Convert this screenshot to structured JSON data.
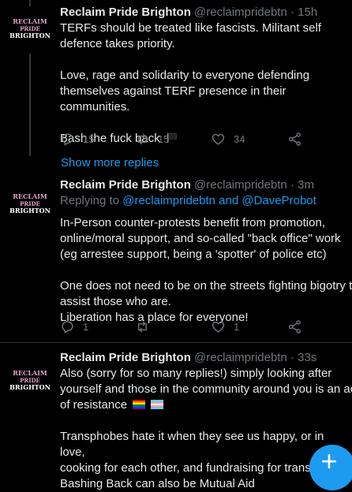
{
  "avatar": {
    "line1": "RECLAIM",
    "line2": "PRIDE",
    "line3": "BRIGHTON"
  },
  "tweets": [
    {
      "name": "Reclaim Pride Brighton",
      "handle": "@reclaimpridebtn",
      "sep": "·",
      "time": "15h",
      "lines": [
        "TERFs should be treated like fascists. Militant self",
        "defence takes priority.",
        "",
        "Love, rage and solidarity to everyone defending",
        "themselves against TERF presence in their communities.",
        "",
        "Bash the fuck back"
      ],
      "replies": "15",
      "retweets": "15",
      "likes": "34"
    },
    {
      "name": "Reclaim Pride Brighton",
      "handle": "@reclaimpridebtn",
      "sep": "·",
      "time": "3m",
      "replying_label": "Replying to",
      "reply_user1": "@reclaimpridebtn",
      "reply_and": "and",
      "reply_user2": "@DaveProbot",
      "lines": [
        "In-Person counter-protests benefit from promotion,",
        "online/moral support, and so-called \"back office\" work",
        "(eg arrestee support, being a 'spotter' of police etc)",
        "",
        "One does not need to be on the streets fighting bigotry to",
        "assist those who are.",
        "Liberation has a place for everyone!"
      ],
      "replies": "1",
      "retweets": "",
      "likes": "1"
    },
    {
      "name": "Reclaim Pride Brighton",
      "handle": "@reclaimpridebtn",
      "sep": "·",
      "time": "33s",
      "lines": [
        "Also (sorry for so many replies!) simply looking after",
        "yourself and those in the community around you is an act",
        "of resistance",
        "",
        "Transphobes hate it when they see us happy, or in love,",
        "cooking for each other, and fundraising for transitions.",
        "Bashing Back can also be Mutual Aid"
      ]
    }
  ],
  "show_more": "Show more replies",
  "compose_icon": "plus-icon",
  "colors": {
    "link": "#1d9bf0",
    "muted": "#71767b",
    "text": "#e7e9ea",
    "background": "#000000"
  }
}
